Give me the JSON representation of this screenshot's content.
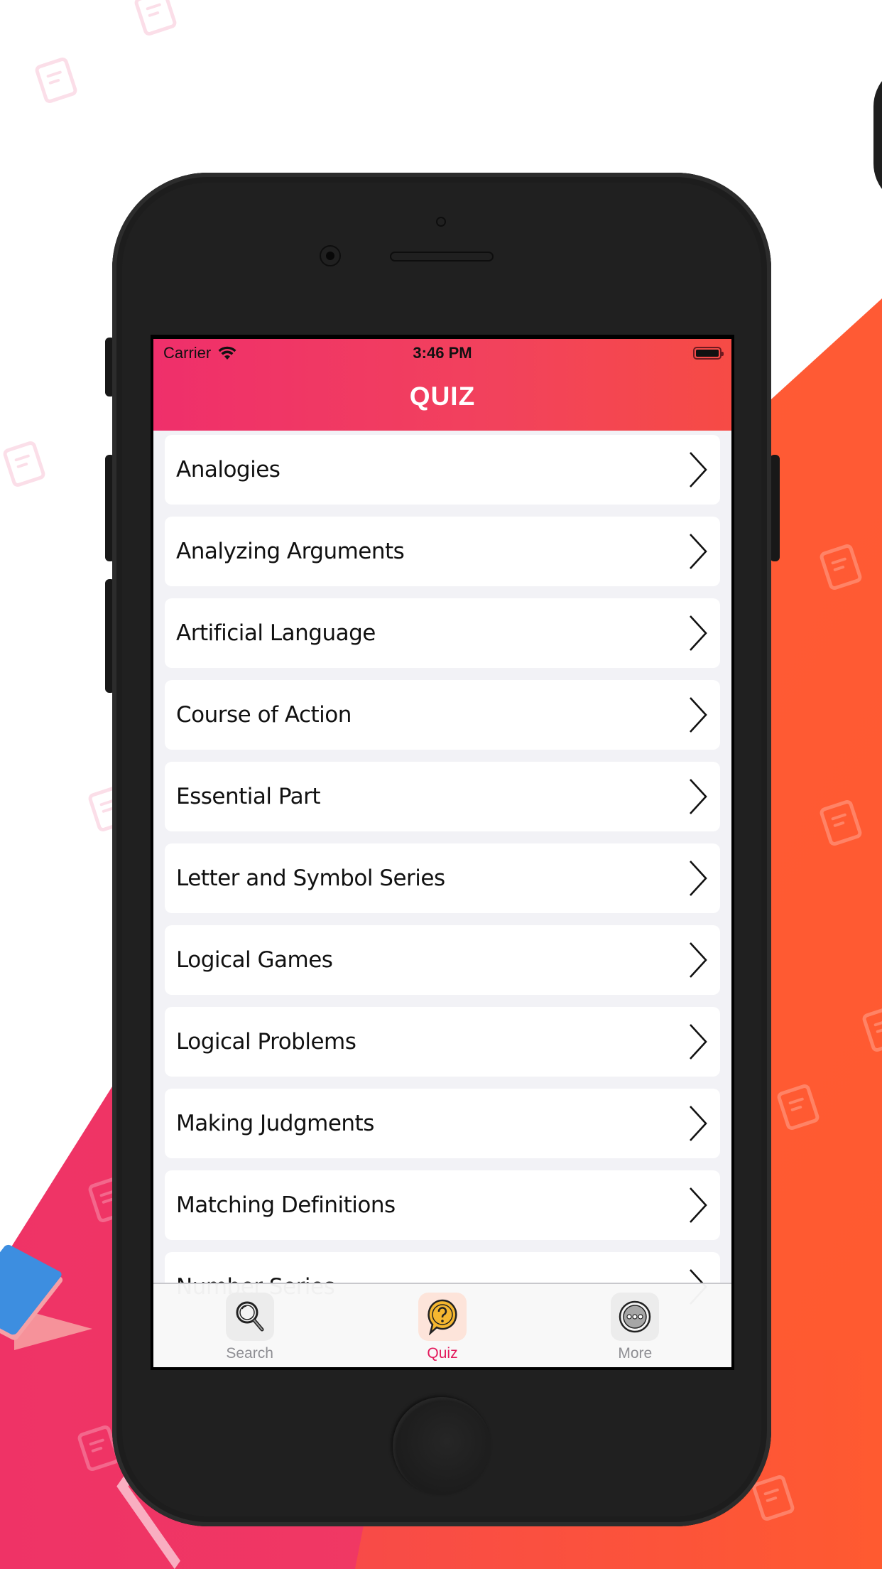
{
  "status_bar": {
    "carrier": "Carrier",
    "time": "3:46 PM",
    "battery_level": 1.0
  },
  "nav": {
    "title": "QUIZ"
  },
  "list": {
    "items": [
      {
        "label": "Analogies"
      },
      {
        "label": "Analyzing Arguments"
      },
      {
        "label": "Artificial Language"
      },
      {
        "label": "Course of Action"
      },
      {
        "label": "Essential Part"
      },
      {
        "label": "Letter and Symbol Series"
      },
      {
        "label": "Logical Games"
      },
      {
        "label": "Logical Problems"
      },
      {
        "label": "Making Judgments"
      },
      {
        "label": "Matching Definitions"
      },
      {
        "label": "Number Series"
      }
    ]
  },
  "tabbar": {
    "tabs": [
      {
        "label": "Search",
        "icon": "magnifier-icon",
        "active": false
      },
      {
        "label": "Quiz",
        "icon": "question-bubble-icon",
        "active": true
      },
      {
        "label": "More",
        "icon": "more-dots-icon",
        "active": false
      }
    ]
  },
  "colors": {
    "header_start": "#ef2f6b",
    "header_end": "#f64b45",
    "active_tab": "#e3195b",
    "inactive_tab": "#8e8e93",
    "list_background": "#f2f2f6"
  }
}
